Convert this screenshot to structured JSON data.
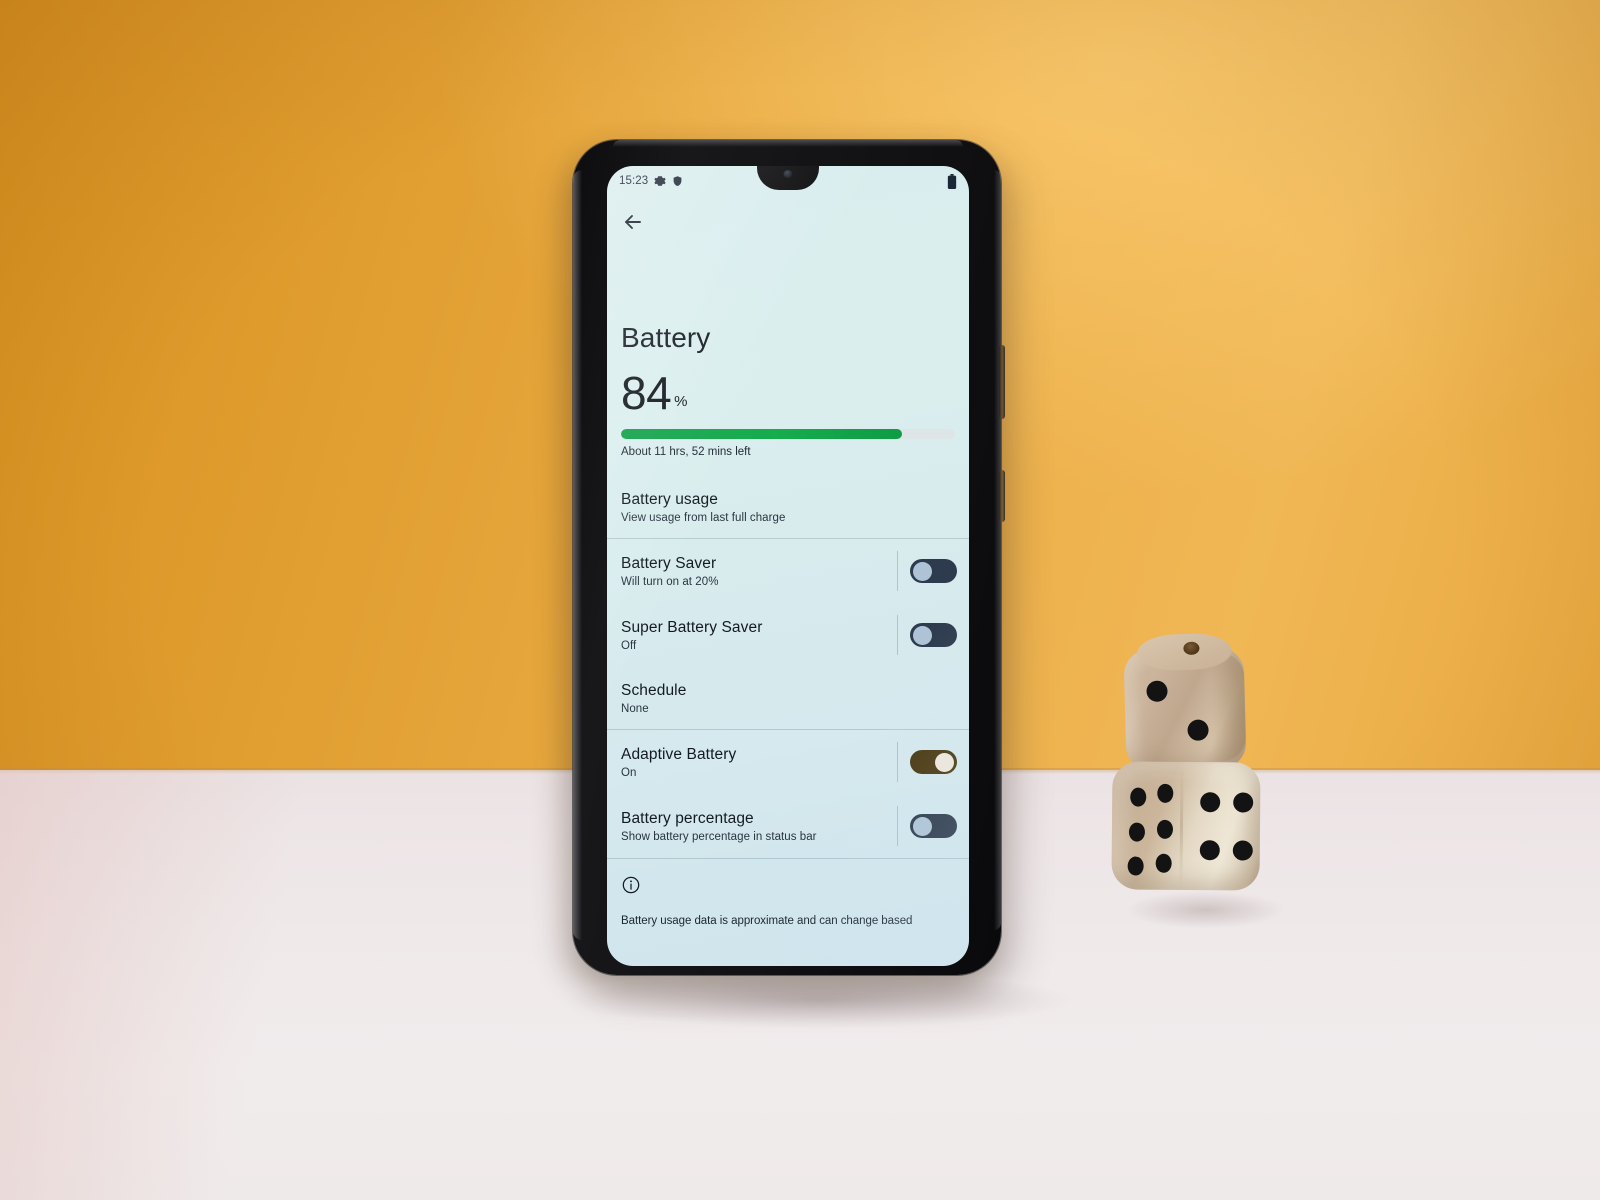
{
  "scene": {
    "wall_color": "#E2A033",
    "table_color": "#EFE9EA",
    "description": "Smartphone standing on a white table against an orange wall with two wooden dice"
  },
  "phone": {
    "frame_color": "#121214",
    "screen_tint": "#D9EDEE"
  },
  "statusbar": {
    "time": "15:23",
    "icons_left": [
      "gear-icon",
      "shield-icon"
    ],
    "icons_right": [
      "battery-icon"
    ]
  },
  "toolbar": {
    "back_label": "back-arrow-icon"
  },
  "page": {
    "title": "Battery"
  },
  "battery": {
    "percent_value": "84",
    "percent_sign": "%",
    "fill_percent": 84,
    "fill_color": "#13A44B",
    "track_color": "#DDE5E6",
    "time_left": "About 11 hrs, 52 mins left"
  },
  "settings": [
    {
      "title": "Battery usage",
      "subtitle": "View usage from last full charge",
      "control": "none",
      "state": ""
    },
    {
      "title": "Battery Saver",
      "subtitle": "Will turn on at 20%",
      "control": "toggle",
      "state": "off"
    },
    {
      "title": "Super Battery Saver",
      "subtitle": "Off",
      "control": "toggle",
      "state": "off"
    },
    {
      "title": "Schedule",
      "subtitle": "None",
      "control": "none",
      "state": ""
    },
    {
      "title": "Adaptive Battery",
      "subtitle": "On",
      "control": "toggle",
      "state": "on"
    },
    {
      "title": "Battery percentage",
      "subtitle": "Show battery percentage in status bar",
      "control": "toggle",
      "state": "off"
    }
  ],
  "footer": {
    "icon": "info-icon",
    "text": "Battery usage data is approximate and can change based"
  },
  "dice": {
    "top": {
      "front_pips": 2,
      "has_top_hole": true,
      "wood_color": "#CBB49C"
    },
    "bottom": {
      "front_pips": 4,
      "side_pips": 6,
      "wood_color": "#E3D8C4"
    }
  }
}
